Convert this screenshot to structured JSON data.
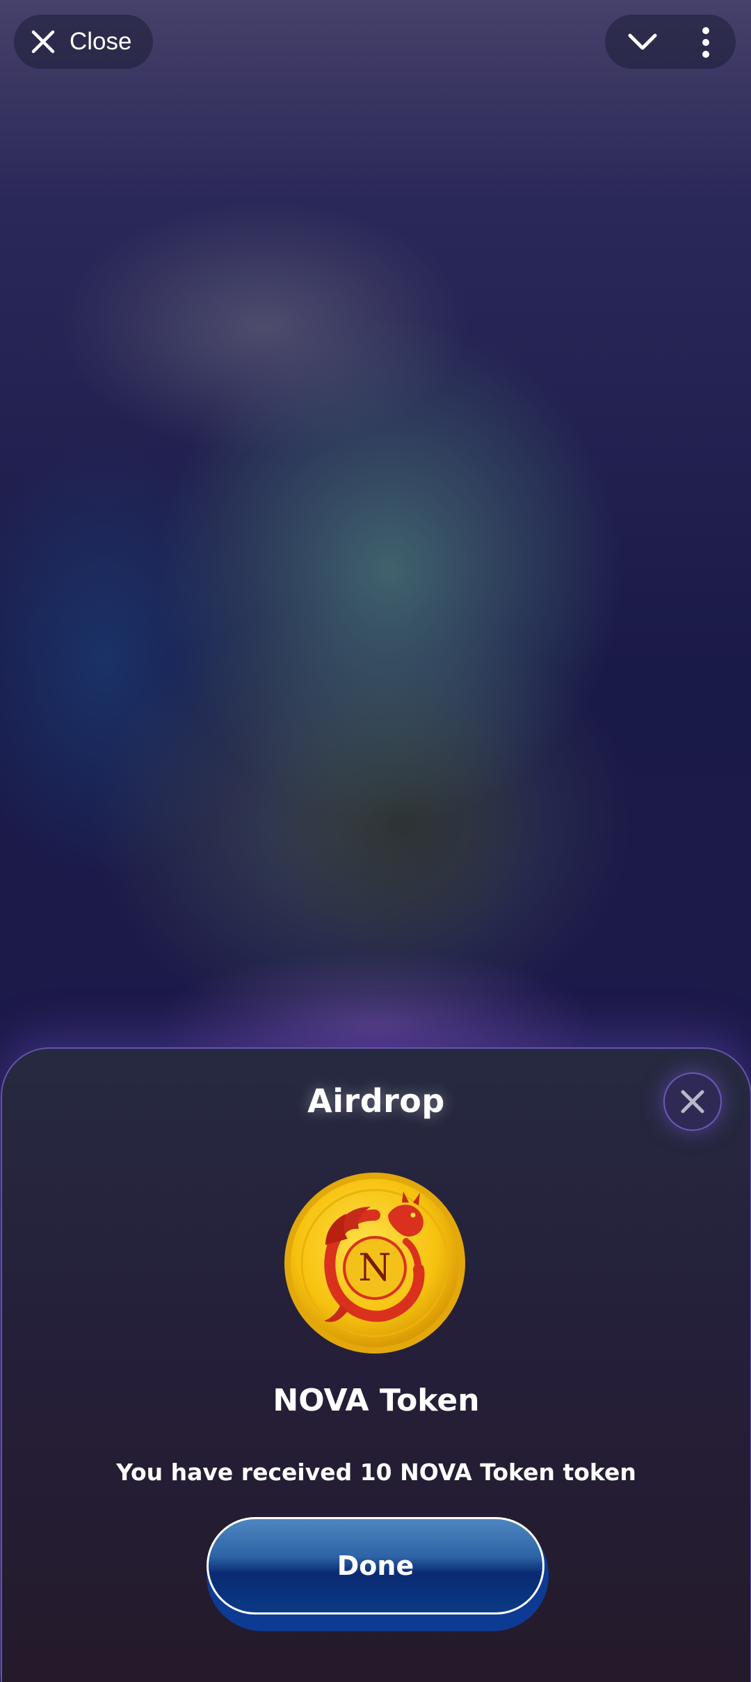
{
  "topbar": {
    "close_label": "Close",
    "close_icon": "close-icon",
    "chevron_icon": "chevron-down-icon",
    "menu_icon": "more-vertical-icon"
  },
  "sheet": {
    "title": "Airdrop",
    "close_icon": "close-icon",
    "token_icon": "nova-token-coin-icon",
    "token_name": "NOVA Token",
    "message": "You have received 10 NOVA Token token",
    "done_label": "Done"
  },
  "colors": {
    "accent_border": "#6753b0",
    "button_blue": "#0a2a72",
    "coin_gold": "#f5c518",
    "dragon_red": "#d9311d"
  }
}
